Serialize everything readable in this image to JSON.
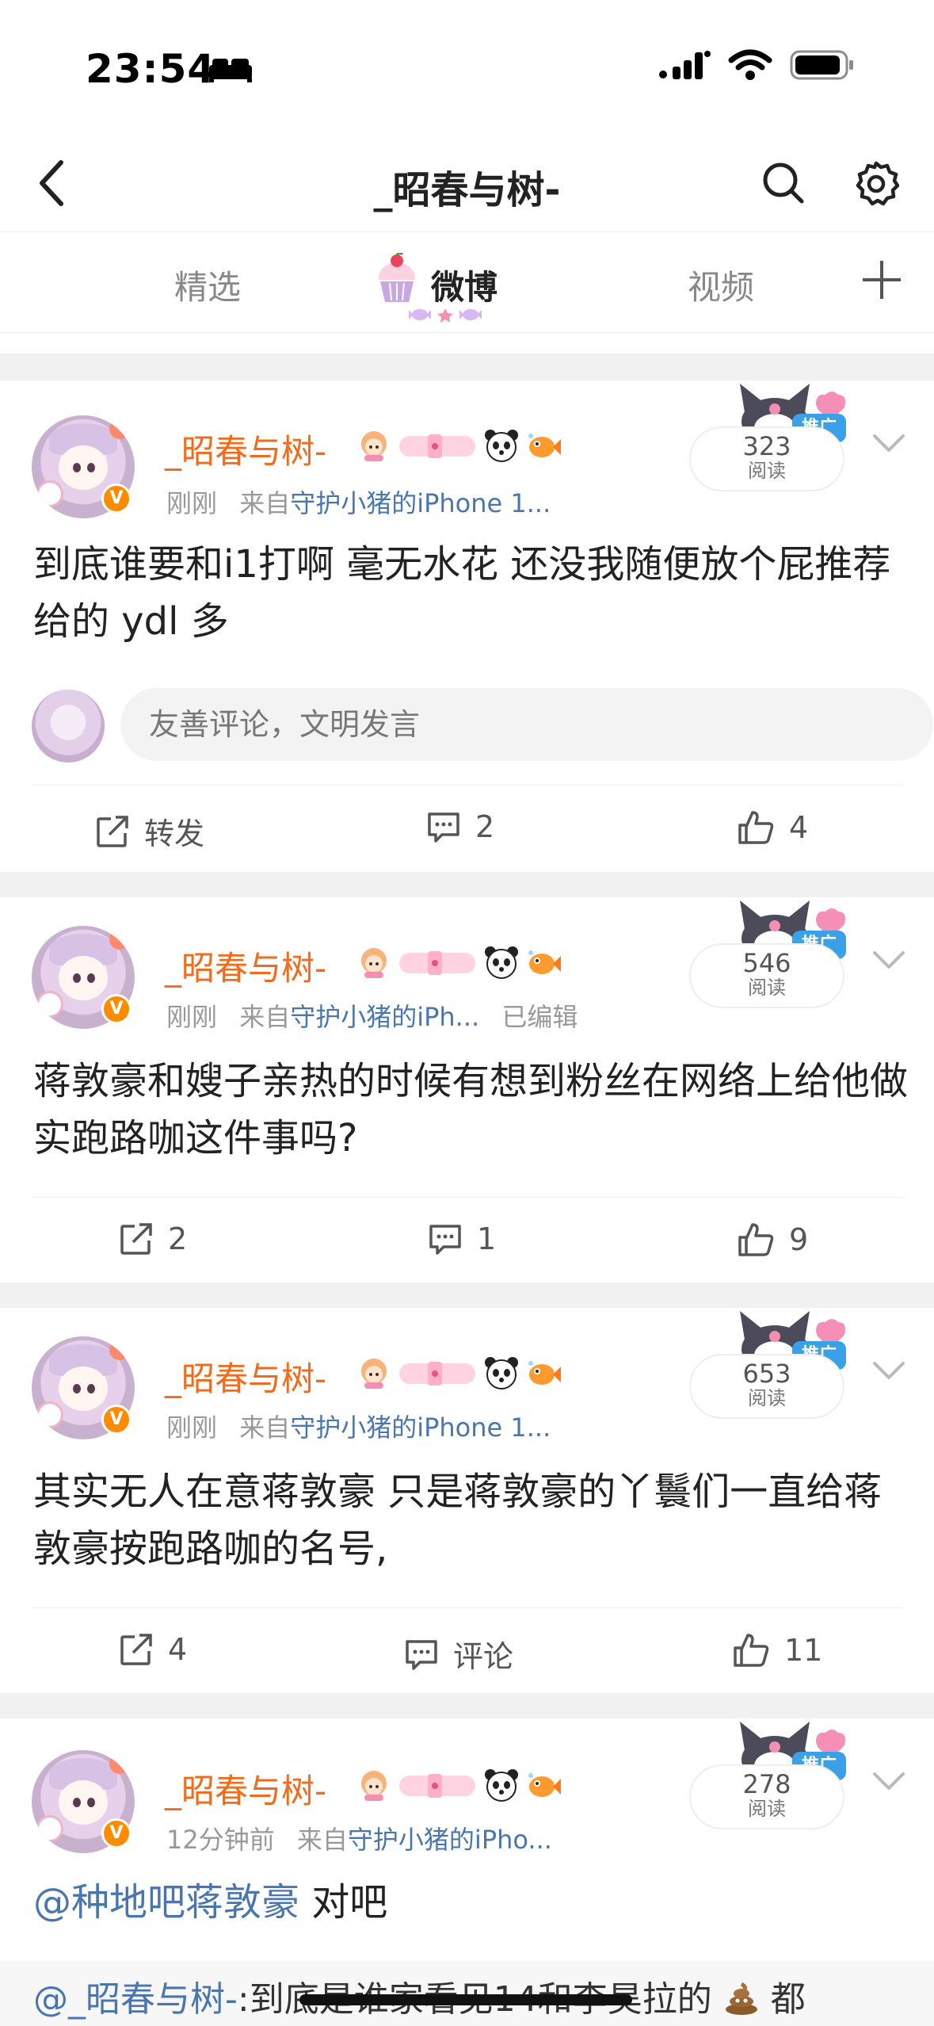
{
  "status_bar": {
    "time": "23:54"
  },
  "nav": {
    "title": "_昭春与树-"
  },
  "tabs": [
    {
      "label": "精选"
    },
    {
      "label": "微博"
    },
    {
      "label": "视频"
    }
  ],
  "posts": [
    {
      "username": "_昭春与树-",
      "time": "刚刚",
      "from_label": "来自",
      "source": "守护小猪的iPhone 1...",
      "edited": "",
      "views": "323",
      "views_label": "阅读",
      "promo_label": "推广",
      "text": "到底谁要和i1打啊 毫无水花 还没我随便放个屁推荐给的 ydl 多",
      "comment_placeholder": "友善评论，文明发言",
      "repost": "转发",
      "comments": "2",
      "likes": "4"
    },
    {
      "username": "_昭春与树-",
      "time": "刚刚",
      "from_label": "来自",
      "source": "守护小猪的iPh...",
      "edited": "已编辑",
      "views": "546",
      "views_label": "阅读",
      "promo_label": "推广",
      "text": "蒋敦豪和嫂子亲热的时候有想到粉丝在网络上给他做实跑路咖这件事吗?",
      "repost": "2",
      "comments": "1",
      "likes": "9"
    },
    {
      "username": "_昭春与树-",
      "time": "刚刚",
      "from_label": "来自",
      "source": "守护小猪的iPhone 1...",
      "edited": "",
      "views": "653",
      "views_label": "阅读",
      "promo_label": "推广",
      "text": "其实无人在意蒋敦豪 只是蒋敦豪的丫鬟们一直给蒋敦豪按跑路咖的名号,",
      "repost": "4",
      "comments": "评论",
      "likes": "11"
    },
    {
      "username": "_昭春与树-",
      "time": "12分钟前",
      "from_label": "来自",
      "source": "守护小猪的iPho...",
      "edited": "",
      "views": "278",
      "views_label": "阅读",
      "promo_label": "推广",
      "mention": "@种地吧蒋敦豪",
      "text_after": " 对吧",
      "quote_mention": "@_昭春与树-",
      "quote_text": ":到底是谁家看见14和李昊拉的",
      "quote_tail": "都"
    }
  ],
  "colors": {
    "username": "#f26b1d",
    "link": "#4a76b0",
    "divider": "#f1f1f1"
  }
}
